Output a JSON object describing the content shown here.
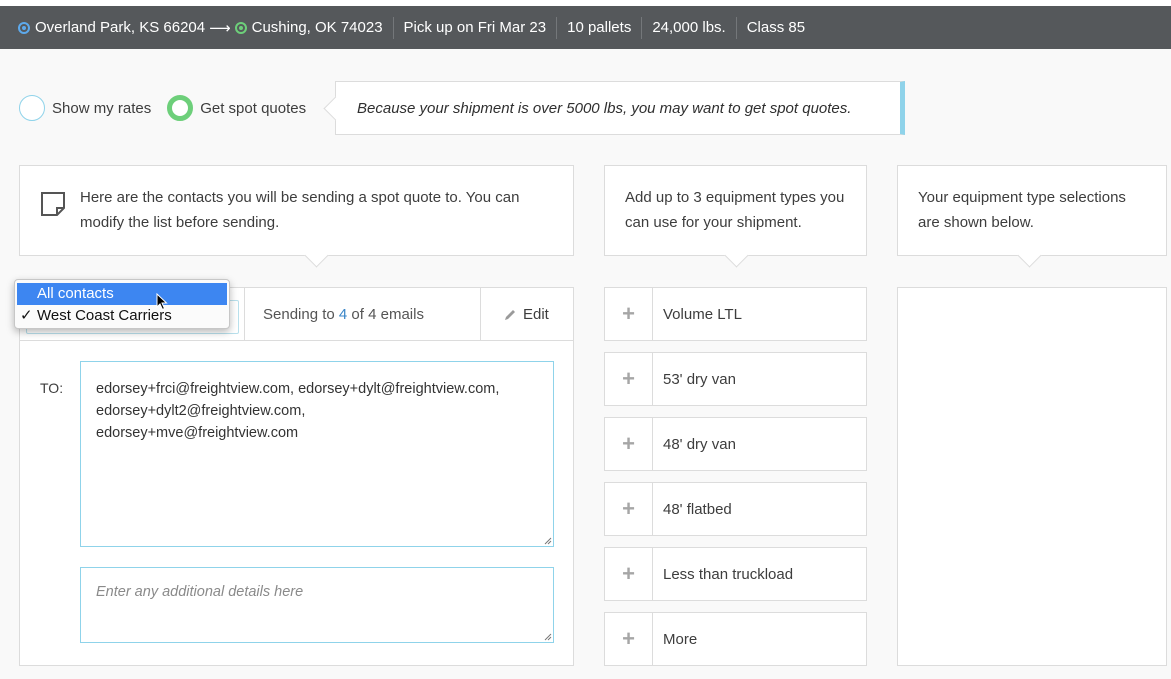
{
  "topbar": {
    "origin": "Overland Park, KS 66204",
    "arrow": "⟶",
    "destination": "Cushing, OK 74023",
    "pickup": "Pick up on Fri Mar 23",
    "pallets": "10 pallets",
    "weight": "24,000 lbs.",
    "class": "Class 85"
  },
  "mode": {
    "option1": "Show my rates",
    "option2": "Get spot quotes",
    "selected": "Get spot quotes",
    "hint": "Because your shipment is over 5000 lbs, you may want to get spot quotes."
  },
  "callouts": {
    "contacts": "Here are the contacts you will be sending a spot quote to. You can modify the list before sending.",
    "equipment": "Add up to 3 equipment types you can use for your shipment.",
    "selections": "Your equipment type selections are shown below."
  },
  "contacts": {
    "sending_prefix": "Sending to ",
    "sending_count": "4",
    "sending_suffix": " of 4 emails",
    "edit_label": "Edit",
    "to_label": "TO:",
    "to_line1": "edorsey+frci@freightview.com, edorsey+dylt@freightview.com,",
    "to_line2": "edorsey+dylt2@freightview.com,",
    "to_line3": "edorsey+mve@freightview.com",
    "details_placeholder": "Enter any additional details here"
  },
  "dropdown": {
    "options": [
      "All contacts",
      "West Coast Carriers"
    ],
    "highlighted": "All contacts",
    "selected": "West Coast Carriers",
    "check": "✓"
  },
  "equipment": {
    "items": [
      "Volume LTL",
      "53' dry van",
      "48' dry van",
      "48' flatbed",
      "Less than truckload",
      "More"
    ],
    "plus": "+"
  },
  "colors": {
    "topbar": "#55585b",
    "accent_green": "#6dcf7a",
    "accent_blue": "#8fd3ea",
    "link_blue": "#3a86c8",
    "highlight": "#3d86f1"
  }
}
